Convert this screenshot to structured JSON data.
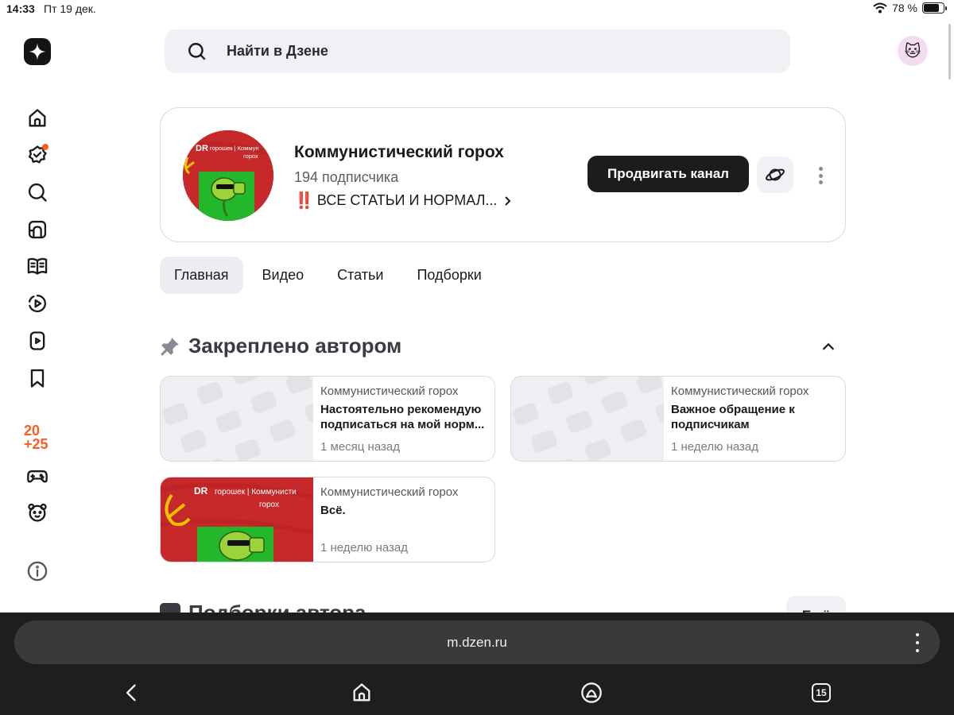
{
  "status_bar": {
    "time": "14:33",
    "date": "Пт 19 дек.",
    "battery": "78 %",
    "battery_level": 0.78
  },
  "sidebar": {
    "items": [
      {
        "name": "home-icon"
      },
      {
        "name": "tasks-icon",
        "has_notification_dot": true
      },
      {
        "name": "search-icon"
      },
      {
        "name": "subscriptions-icon"
      },
      {
        "name": "articles-icon"
      },
      {
        "name": "video-icon"
      },
      {
        "name": "shorts-icon"
      },
      {
        "name": "bookmark-icon"
      },
      {
        "name": "year-2025-icon"
      },
      {
        "name": "games-icon"
      },
      {
        "name": "kids-icon"
      },
      {
        "name": "info-icon"
      }
    ],
    "year_badge_line1": "20",
    "year_badge_line2": "+25"
  },
  "search": {
    "placeholder": "Найти в Дзене"
  },
  "channel": {
    "title": "Коммунистический горох",
    "subscribers": "194 подписчика",
    "description_marker": "‼️",
    "description": "ВСЕ СТАТЬИ И НОРМАЛ...",
    "promote_label": "Продвигать канал",
    "avatar_text_line1": "DR горошек | Коммунистический",
    "avatar_text_line2": "горох"
  },
  "tabs": [
    {
      "label": "Главная",
      "active": true
    },
    {
      "label": "Видео",
      "active": false
    },
    {
      "label": "Статьи",
      "active": false
    },
    {
      "label": "Подборки",
      "active": false
    }
  ],
  "pinned": {
    "title": "Закреплено автором",
    "posts": [
      {
        "author": "Коммунистический горох",
        "title": "Настоятельно рекомендую подписаться на мой норм...",
        "time": "1 месяц назад",
        "thumb": "placeholder"
      },
      {
        "author": "Коммунистический горох",
        "title": "Важное обращение к подписчикам",
        "time": "1 неделю назад",
        "thumb": "placeholder"
      },
      {
        "author": "Коммунистический горох",
        "title": "Всё.",
        "time": "1 неделю назад",
        "thumb": "channel-art"
      }
    ]
  },
  "next_section": {
    "title": "Подборки автора",
    "more_label": "Ещё"
  },
  "browser": {
    "url": "m.dzen.ru",
    "tabs_count": "15"
  },
  "colors": {
    "accent": "#ff5a1f",
    "primary_button": "#1c1c1e",
    "channel_red": "#c7292b",
    "pea_green": "#22b530"
  }
}
